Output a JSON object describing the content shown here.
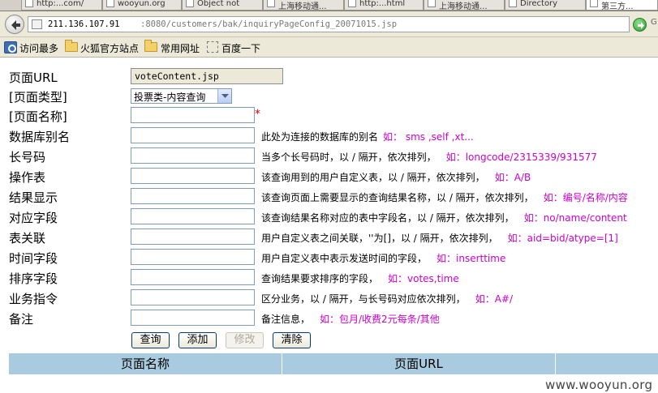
{
  "tabs": [
    {
      "label": "http:...com/"
    },
    {
      "label": "wooyun.org"
    },
    {
      "label": "Object not"
    },
    {
      "label": "上海移动通..."
    },
    {
      "label": "http:...html"
    },
    {
      "label": "上海移动通..."
    },
    {
      "label": "Directory"
    },
    {
      "label": "第三方..."
    }
  ],
  "address": {
    "host": "211.136.107.91",
    "path": ":8080/customers/bak/inquiryPageConfig_20071015.jsp"
  },
  "navbar_edge": "G",
  "bookmarks": [
    {
      "label": "访问最多",
      "icon": "most-visited-icon"
    },
    {
      "label": "火狐官方站点",
      "icon": "folder-icon"
    },
    {
      "label": "常用网址",
      "icon": "folder-icon"
    },
    {
      "label": "百度一下",
      "icon": "bookmark-icon"
    }
  ],
  "form": {
    "page_url": {
      "label": "页面URL",
      "value": "voteContent.jsp"
    },
    "page_type": {
      "label": "[页面类型]",
      "selected": "投票类-内容查询"
    },
    "page_name": {
      "label": "[页面名称]",
      "required_mark": "*"
    },
    "db_alias": {
      "label": "数据库别名",
      "hint": "此处为连接的数据库的别名",
      "example": "如： sms ,self ,xt..."
    },
    "long_code": {
      "label": "长号码",
      "hint": "当多个长号码时，以 / 隔开，依次排列，",
      "example": "如：longcode/2315339/931577"
    },
    "op_table": {
      "label": "操作表",
      "hint": "该查询用到的用户自定义表，以 / 隔开，依次排列，",
      "example": "如：A/B"
    },
    "result_display": {
      "label": "结果显示",
      "hint": "该查询页面上需要显示的查询结果名称，以 / 隔开，依次排列，",
      "example": "如：编号/名称/内容"
    },
    "field_map": {
      "label": "对应字段",
      "hint": "该查询结果名称对应的表中字段名，以 / 隔开，依次排列，",
      "example": "如：no/name/content"
    },
    "table_join": {
      "label": "表关联",
      "hint": "用户自定义表之间关联，''为[]，以 / 隔开，依次排列，",
      "example": "如：aid=bid/atype=[1]"
    },
    "time_field": {
      "label": "时间字段",
      "hint": "用户自定义表中表示发送时间的字段，",
      "example": "如：inserttime"
    },
    "sort_field": {
      "label": "排序字段",
      "hint": "查询结果要求排序的字段，",
      "example": "如：votes,time"
    },
    "business_cmd": {
      "label": "业务指令",
      "hint": "区分业务，以 / 隔开，与长号码对应依次排列，",
      "example": "如：A#/"
    },
    "remark": {
      "label": "备注",
      "hint": "备注信息，",
      "example": "如：包月/收费2元每条/其他"
    }
  },
  "buttons": {
    "query": "查询",
    "add": "添加",
    "modify": "修改",
    "clear": "清除"
  },
  "table": {
    "headers": [
      "页面名称",
      "页面URL",
      ""
    ]
  },
  "watermark": "www.wooyun.org",
  "colors": {
    "example_text": "#cc00cc",
    "required_mark": "#e00000",
    "table_header_bg": "#a9cbe0"
  }
}
